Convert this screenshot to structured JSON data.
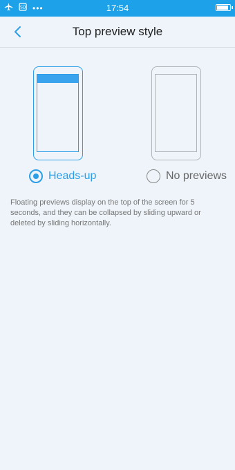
{
  "status_bar": {
    "time": "17:54",
    "icons": [
      "airplane-icon",
      "sim-icon",
      "more-dots-icon",
      "battery-icon"
    ],
    "sim_label": "SD",
    "dots": "•••"
  },
  "header": {
    "back_icon": "chevron-left-icon",
    "title": "Top preview style"
  },
  "options": [
    {
      "label": "Heads-up",
      "selected": true
    },
    {
      "label": "No previews",
      "selected": false
    }
  ],
  "description": "Floating previews display on the top of the screen for 5 seconds, and they can be collapsed by sliding upward or deleted by sliding horizontally.",
  "colors": {
    "accent": "#2b9ee8",
    "status_bar": "#1da1e8",
    "background": "#eef4f9"
  }
}
